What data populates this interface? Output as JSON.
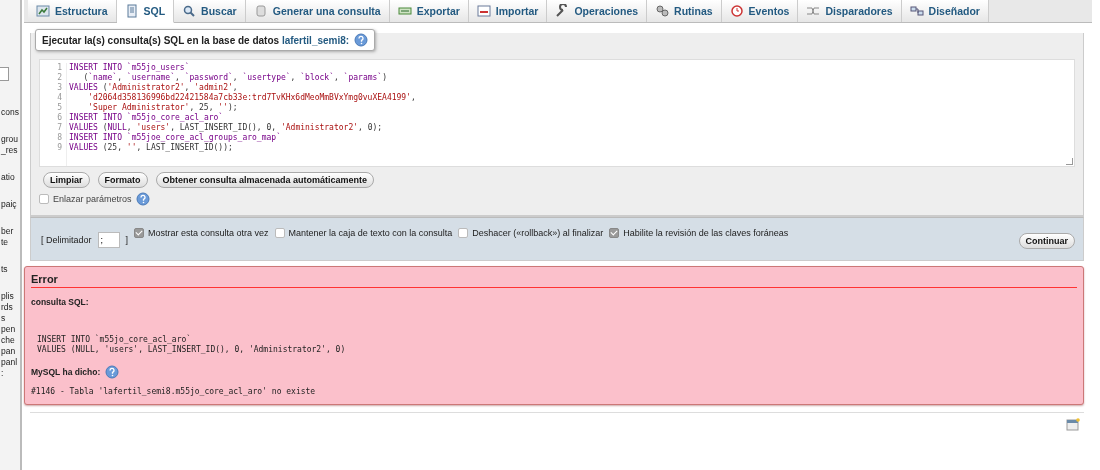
{
  "sidebar": {
    "groups": [
      [
        "cons"
      ],
      [
        "grou",
        "_res"
      ],
      [
        "atio"
      ],
      [
        "paiç"
      ],
      [
        "ber",
        "te"
      ],
      [
        "ts"
      ],
      [
        "plis",
        "rds",
        "s",
        "pen",
        "che",
        "pan",
        "panl",
        ":"
      ]
    ]
  },
  "tabs": [
    {
      "label": "Estructura",
      "selected": false
    },
    {
      "label": "SQL",
      "selected": true
    },
    {
      "label": "Buscar",
      "selected": false
    },
    {
      "label": "Generar una consulta",
      "selected": false
    },
    {
      "label": "Exportar",
      "selected": false
    },
    {
      "label": "Importar",
      "selected": false
    },
    {
      "label": "Operaciones",
      "selected": false
    },
    {
      "label": "Rutinas",
      "selected": false
    },
    {
      "label": "Eventos",
      "selected": false
    },
    {
      "label": "Disparadores",
      "selected": false
    },
    {
      "label": "Diseñador",
      "selected": false
    }
  ],
  "query_panel": {
    "legend": "Ejecutar la(s) consulta(s) SQL en la base de datos",
    "database": "lafertil_semi8:",
    "editor": {
      "lines": [
        {
          "number": "1",
          "code": "INSERT INTO `m55jo_users`"
        },
        {
          "number": "2",
          "code": "   (`name`, `username`, `password`, `usertype`, `block`, `params`)"
        },
        {
          "number": "3",
          "code": "VALUES ('Administrator2', 'admin2',"
        },
        {
          "number": "4",
          "code": "    'd2064d358136996bd22421584a7cb33e:trd7TvKHx6dMeoMmBVxYmg0vuXEA4199',"
        },
        {
          "number": "5",
          "code": "    'Super Administrator', 25, '');"
        },
        {
          "number": "6",
          "code": "INSERT INTO `m55jo_core_acl_aro`"
        },
        {
          "number": "7",
          "code": "VALUES (NULL, 'users', LAST_INSERT_ID(), 0, 'Administrator2', 0);"
        },
        {
          "number": "8",
          "code": "INSERT INTO `m55joe_core_acl_groups_aro_map`"
        },
        {
          "number": "9",
          "code": "VALUES (25, '', LAST_INSERT_ID());"
        }
      ]
    },
    "buttons": [
      "Limpiar",
      "Formato",
      "Obtener consulta almacenada automáticamente"
    ],
    "bind_parameters": {
      "label": "Enlazar parámetros",
      "checked": false
    }
  },
  "options": {
    "delimiter_open": "[ Delimitador",
    "delimiter_value": ";",
    "delimiter_close": "]",
    "checkboxes": [
      {
        "label": "Mostrar esta consulta otra vez",
        "checked": true
      },
      {
        "label": "Mantener la caja de texto con la consulta",
        "checked": false
      },
      {
        "label": "Deshacer («rollback») al finalizar",
        "checked": false
      },
      {
        "label": "Habilite la revisión de las claves foráneas",
        "checked": true
      }
    ],
    "submit": "Continuar"
  },
  "error": {
    "title": "Error",
    "sql_heading": "consulta SQL:",
    "sql_lines": [
      "INSERT INTO `m55jo_core_acl_aro`",
      "VALUES (NULL, 'users', LAST_INSERT_ID(), 0, 'Administrator2', 0)"
    ],
    "mysql_heading": "MySQL ha dicho:",
    "message": "#1146 - Tabla 'lafertil_semi8.m55jo_core_acl_aro' no existe"
  }
}
